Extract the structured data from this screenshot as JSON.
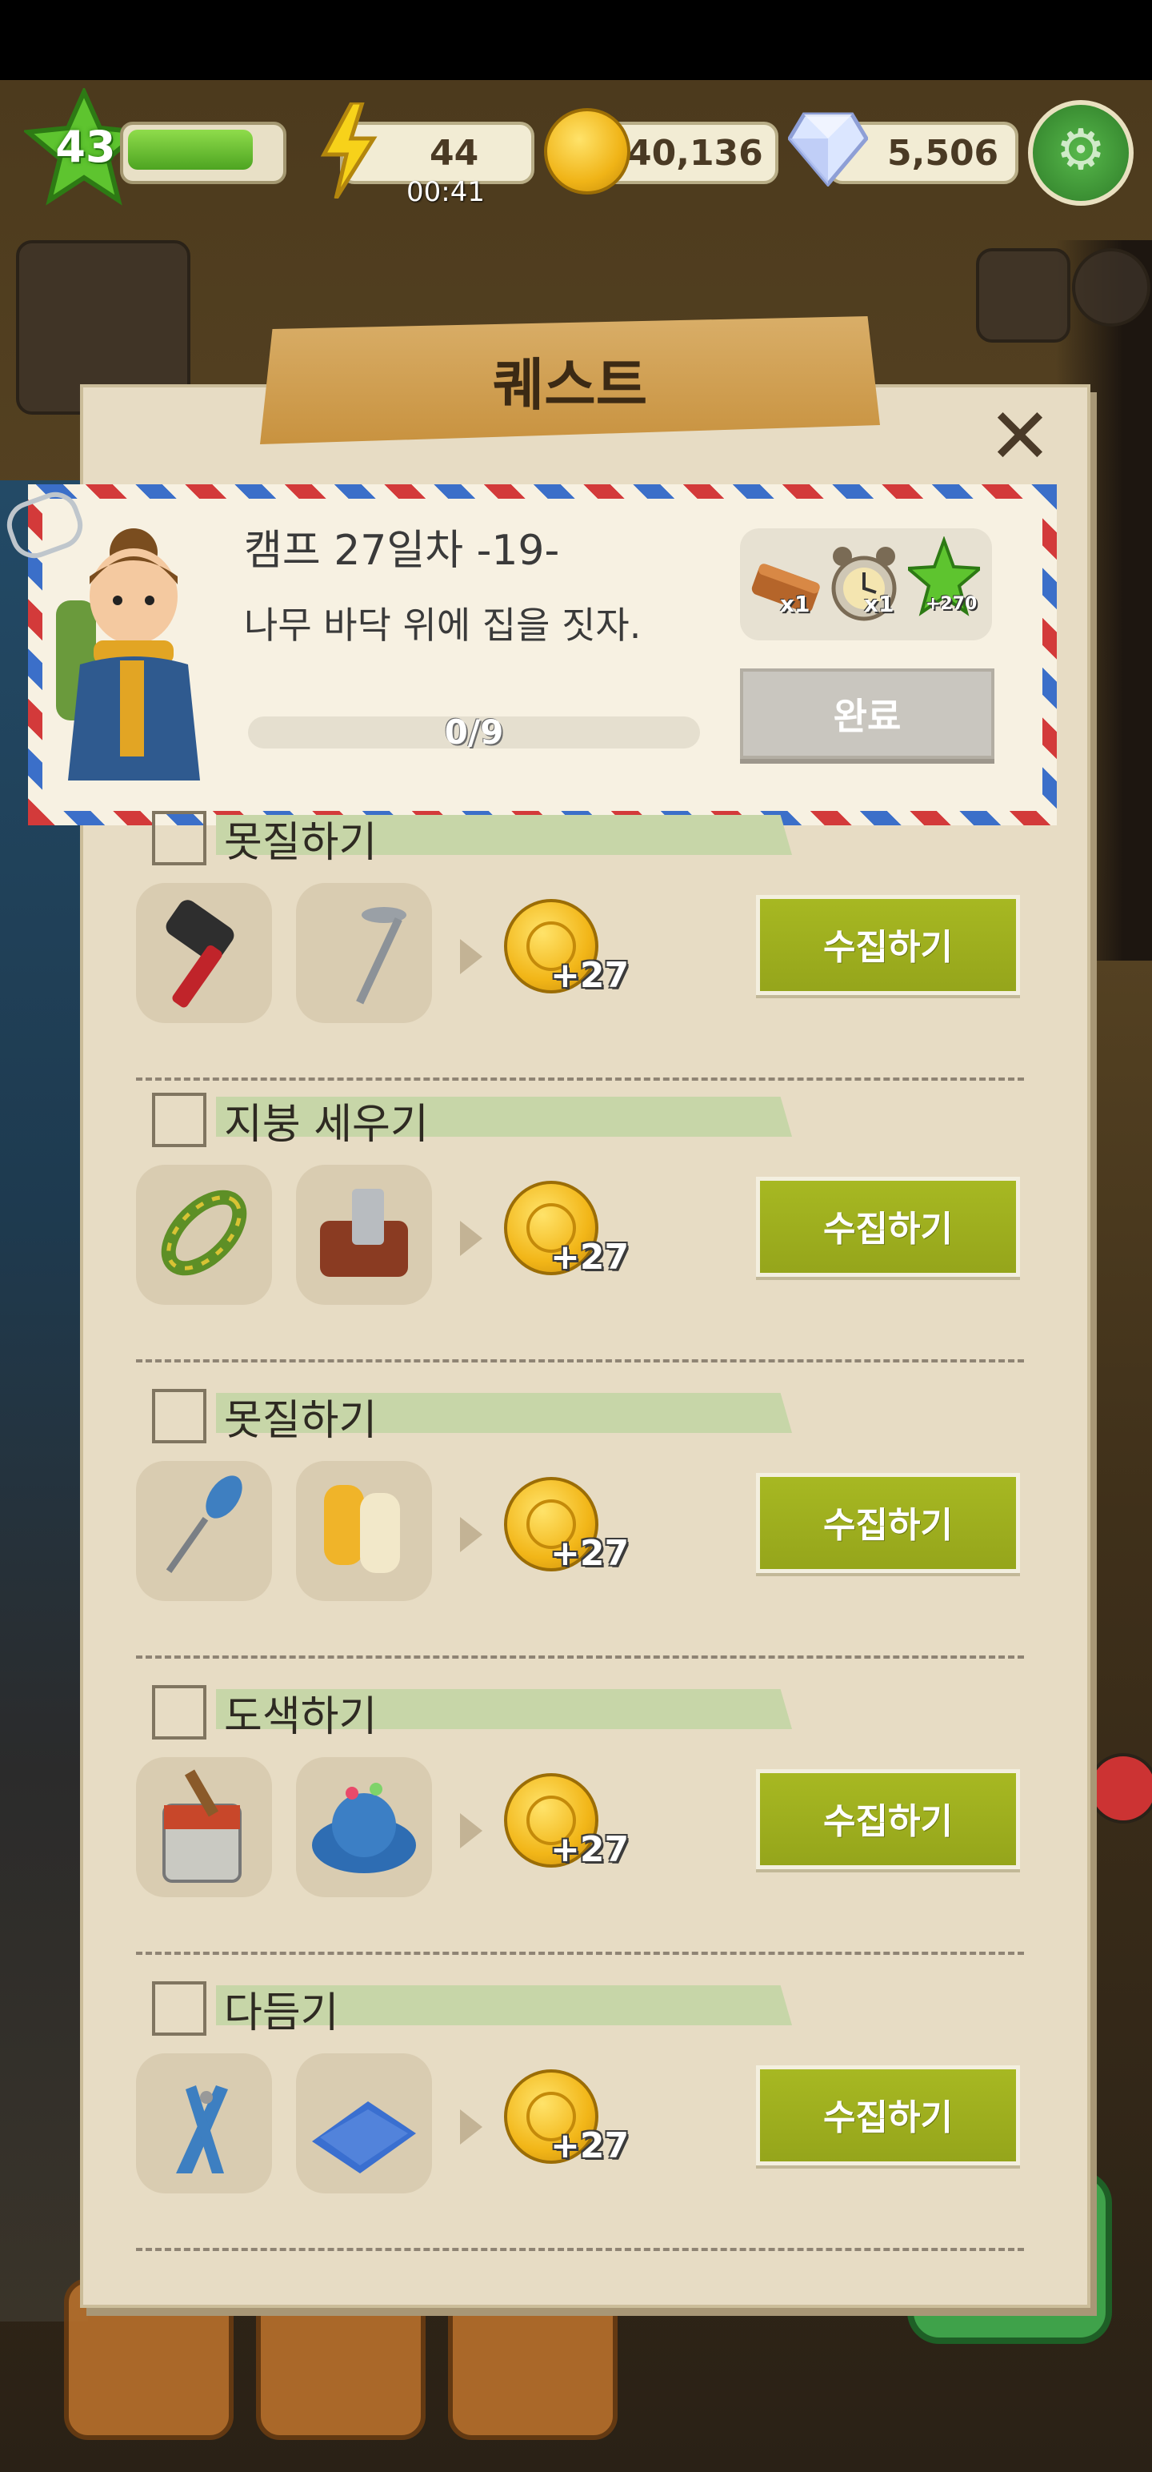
{
  "hud": {
    "level": "43",
    "xp_progress": 0.85,
    "energy": "44",
    "energy_timer": "00:41",
    "coins": "40,136",
    "gems": "5,506"
  },
  "panel": {
    "title": "퀘스트",
    "quest_title": "캠프 27일차 -19-",
    "quest_subtitle": "나무 바닥 위에 집을 짓자.",
    "progress_text": "0/9",
    "progress": 0,
    "rewards": [
      {
        "icon": "wood-plank-icon",
        "count": "x1"
      },
      {
        "icon": "alarm-clock-icon",
        "count": "x1"
      },
      {
        "icon": "xp-star-icon",
        "count": "+270"
      }
    ],
    "complete_label": "완료"
  },
  "tasks": [
    {
      "name": "못질하기",
      "items": [
        "hammer-icon",
        "nail-icon"
      ],
      "reward": "+27",
      "button": "수집하기"
    },
    {
      "name": "지붕 세우기",
      "items": [
        "rope-icon",
        "hand-plane-icon"
      ],
      "reward": "+27",
      "button": "수집하기"
    },
    {
      "name": "못질하기",
      "items": [
        "awl-icon",
        "work-gloves-icon"
      ],
      "reward": "+27",
      "button": "수집하기"
    },
    {
      "name": "도색하기",
      "items": [
        "paint-bucket-icon",
        "pincushion-icon"
      ],
      "reward": "+27",
      "button": "수집하기"
    },
    {
      "name": "다듬기",
      "items": [
        "pliers-icon",
        "blue-fabric-icon"
      ],
      "reward": "+27",
      "button": "수집하기"
    }
  ],
  "colors": {
    "panel_bg": "#e7dcc4",
    "collect_button": "#a7b822",
    "complete_button": "#c9c6bf",
    "banner": "#d1a254"
  }
}
